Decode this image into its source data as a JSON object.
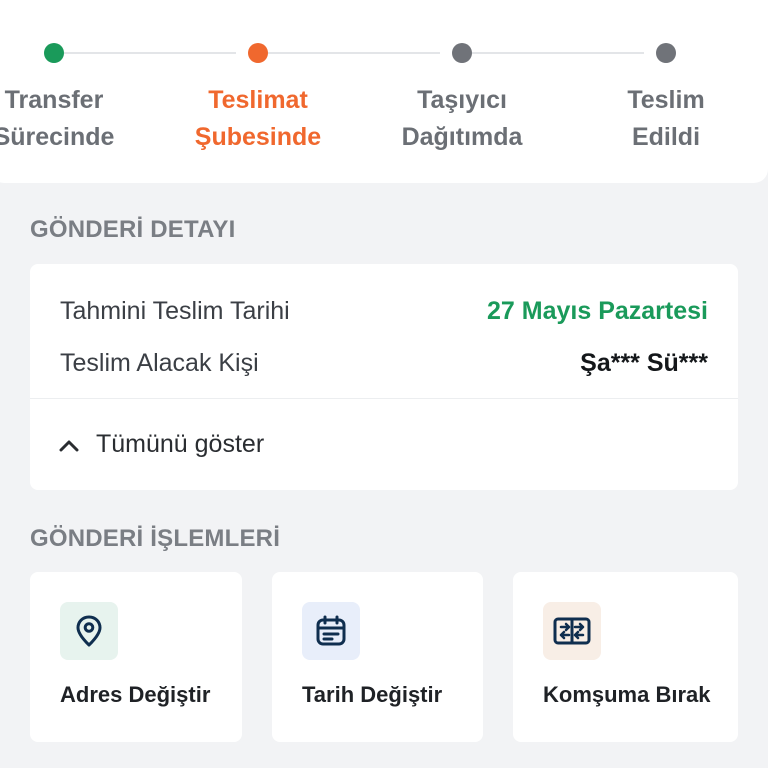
{
  "tracker": {
    "steps": [
      {
        "label": "Transfer\nSürecinde",
        "color": "#1a9a5a",
        "label_color": "#6b6f75"
      },
      {
        "label": "Teslimat\nŞubesinde",
        "color": "#f0682e",
        "label_color": "#f0682e"
      },
      {
        "label": "Taşıyıcı\nDağıtımda",
        "color": "#707379",
        "label_color": "#6b6f75"
      },
      {
        "label": "Teslim\nEdildi",
        "color": "#707379",
        "label_color": "#6b6f75"
      }
    ]
  },
  "detail": {
    "section_title": "GÖNDERİ DETAYI",
    "rows": [
      {
        "label": "Tahmini Teslim Tarihi",
        "value": "27 Mayıs Pazartesi",
        "value_color": "#1a9a5a"
      },
      {
        "label": "Teslim Alacak Kişi",
        "value": "Şa*** Sü***",
        "value_color": "#14171a"
      }
    ],
    "show_all": "Tümünü göster"
  },
  "actions": {
    "section_title": "GÖNDERİ İŞLEMLERİ",
    "items": [
      {
        "label": "Adres Değiştir",
        "icon": "location-pin-icon",
        "icon_bg": "#e7f3ee"
      },
      {
        "label": "Tarih Değiştir",
        "icon": "calendar-icon",
        "icon_bg": "#e8eefa"
      },
      {
        "label": "Komşuma Bırak",
        "icon": "transfer-icon",
        "icon_bg": "#f8eee6"
      }
    ]
  }
}
